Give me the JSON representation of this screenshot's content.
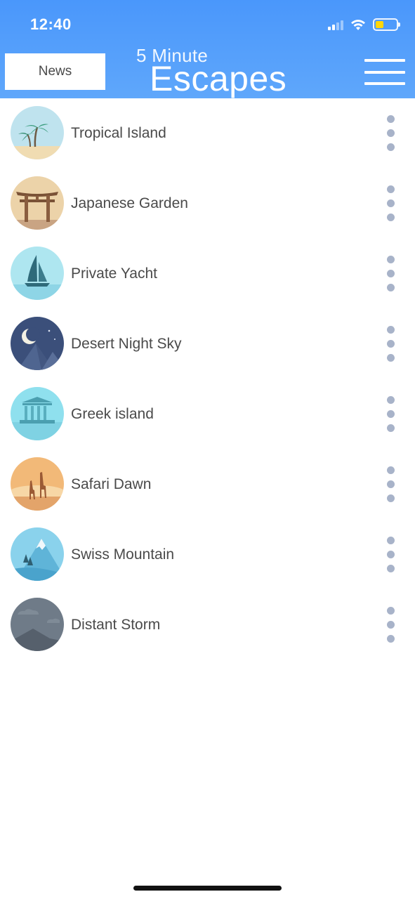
{
  "status_bar": {
    "time": "12:40"
  },
  "header": {
    "news_label": "News",
    "title_small": "5 Minute",
    "title_large": "Escapes"
  },
  "escapes": [
    {
      "label": "Tropical Island",
      "icon": "palm-tree-icon"
    },
    {
      "label": "Japanese Garden",
      "icon": "torii-gate-icon"
    },
    {
      "label": "Private Yacht",
      "icon": "sailboat-icon"
    },
    {
      "label": "Desert Night Sky",
      "icon": "moon-pyramids-icon"
    },
    {
      "label": "Greek island",
      "icon": "greek-temple-icon"
    },
    {
      "label": "Safari Dawn",
      "icon": "giraffes-icon"
    },
    {
      "label": "Swiss Mountain",
      "icon": "mountain-icon"
    },
    {
      "label": "Distant Storm",
      "icon": "storm-clouds-icon"
    }
  ],
  "colors": {
    "header": "#4a97fb",
    "label_text": "#4a4a4a",
    "more_dots": "#a8b3c9"
  }
}
